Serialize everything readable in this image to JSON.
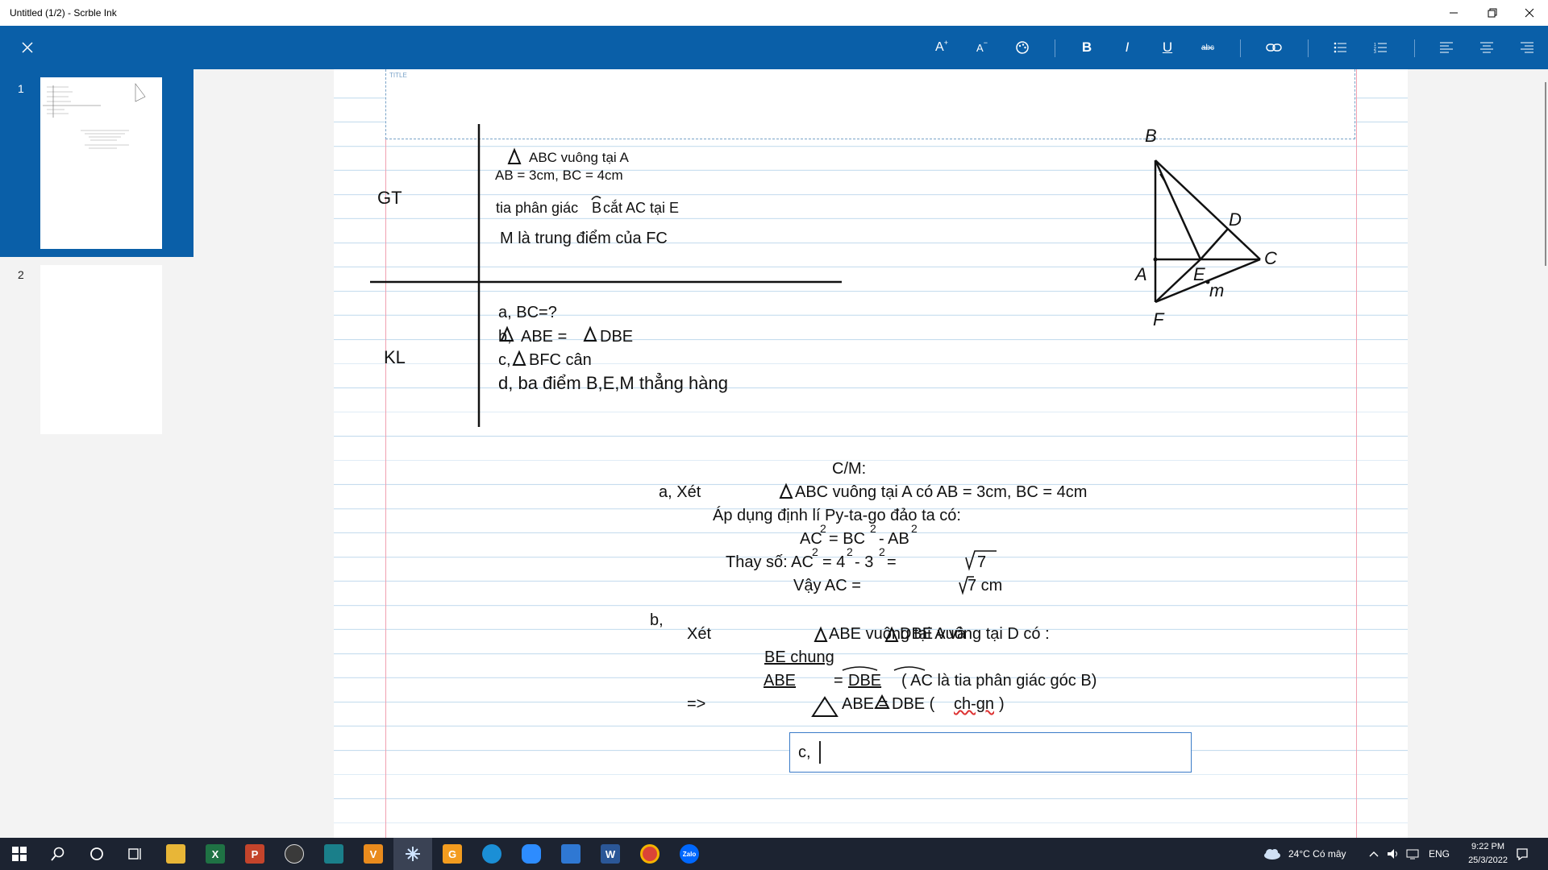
{
  "window": {
    "title": "Untitled (1/2) - Scrble Ink",
    "minimize_icon": "minimize-icon",
    "restore_icon": "restore-icon",
    "close_icon": "close-icon"
  },
  "toolbar": {
    "close_icon": "close-icon",
    "grow_font_label": "A",
    "shrink_font_label": "A",
    "bold_label": "B",
    "italic_label": "I",
    "underline_label": "U",
    "strike_label": "abc",
    "accent_color": "#0a5fa8"
  },
  "sidebar": {
    "pages": [
      {
        "number": "1",
        "selected": true
      },
      {
        "number": "2",
        "selected": false
      }
    ]
  },
  "document": {
    "title_label": "TITLE",
    "gt_label": "GT",
    "kl_label": "KL",
    "gt_lines": [
      "ABC vuông tại A",
      "AB = 3cm, BC = 4cm",
      "tia phân giác",
      "B",
      "cắt AC tại E",
      "M là trung điểm của FC"
    ],
    "kl_lines": [
      "a, BC=?",
      "b,",
      "ABE =",
      "DBE",
      "c,",
      "BFC cân",
      "d, ba điểm B,E,M thẳng hàng"
    ],
    "figure_labels": [
      "B",
      "D",
      "A",
      "E",
      "C",
      "m",
      "F"
    ],
    "proof": {
      "heading": "C/M:",
      "part_a": [
        "a, Xét",
        "ABC vuông tại A có AB = 3cm, BC = 4cm",
        "Áp dụng định lí Py-ta-go đảo ta có:",
        "AC",
        "= BC",
        "- AB",
        "Thay số: AC",
        "= 4",
        "- 3",
        "=",
        "7",
        "Vậy AC =",
        "7 cm"
      ],
      "exponent": "2",
      "part_b_label": "b,",
      "part_b": [
        "Xét",
        "ABE vuông tại A và",
        "DBE vuông tại D có :",
        "BE chung",
        "ABE",
        "=",
        "DBE",
        "( AC là tia phân giác góc B)",
        "=>",
        "ABE =",
        "DBE ( ",
        "ch-gn",
        ")"
      ],
      "part_c_label": "c,"
    }
  },
  "taskbar": {
    "weather": "24°C  Có mây",
    "language": "ENG",
    "time": "9:22 PM",
    "date": "25/3/2022",
    "apps": [
      "start-icon",
      "search-icon",
      "cortana-icon",
      "task-view-icon",
      "file-explorer-icon",
      "excel-icon",
      "powerpoint-icon",
      "obs-icon",
      "app-icon",
      "vlc-icon",
      "scrble-ink-icon",
      "app-g-icon",
      "edge-icon",
      "zoom-icon",
      "store-icon",
      "word-icon",
      "chrome-icon",
      "zalo-icon"
    ]
  }
}
